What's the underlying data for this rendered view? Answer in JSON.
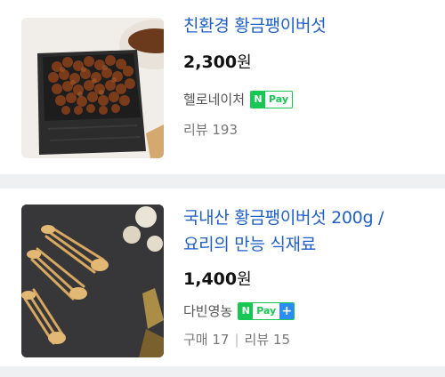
{
  "products": [
    {
      "title": "친환경 황금팽이버섯",
      "price_number": "2,300",
      "price_unit": "원",
      "seller": "헬로네이처",
      "npay": {
        "n": "N",
        "pay": "Pay"
      },
      "review_label": "리뷰 193"
    },
    {
      "title_line1": "국내산 황금팽이버섯 200g /",
      "title_line2": "요리의 만능 식재료",
      "price_number": "1,400",
      "price_unit": "원",
      "seller": "다빈영농",
      "npay": {
        "n": "N",
        "pay": "Pay",
        "plus": "+"
      },
      "purchase_label": "구매 17",
      "separator": "|",
      "review_label": "리뷰 15"
    }
  ],
  "colors": {
    "title": "#1f5fc9",
    "npay_green": "#17c653",
    "plus_blue": "#2d8cf0"
  }
}
